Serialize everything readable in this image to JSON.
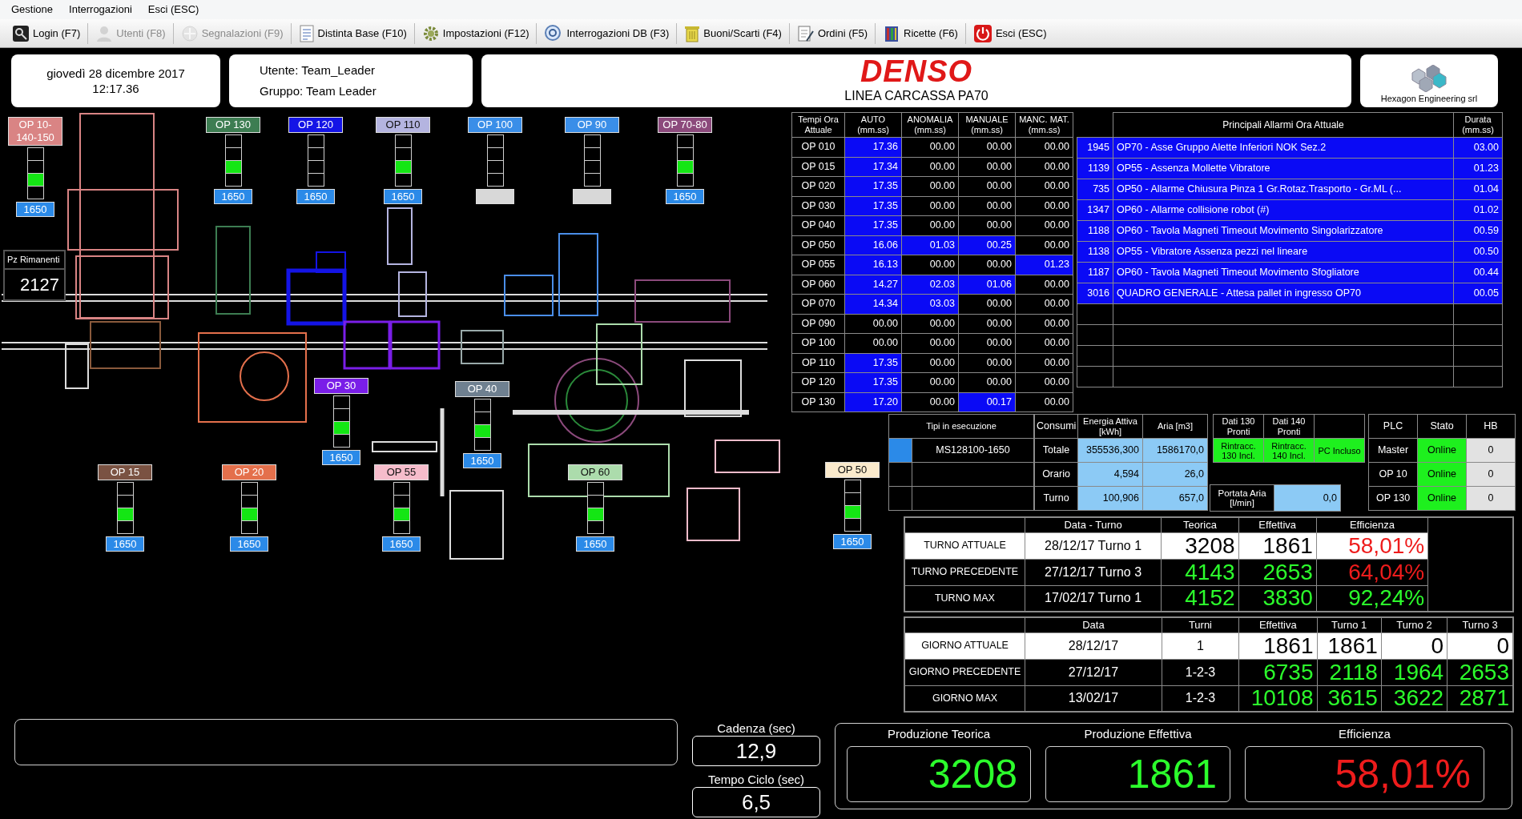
{
  "menu": [
    "Gestione",
    "Interrogazioni",
    "Esci (ESC)"
  ],
  "toolbar": [
    {
      "label": "Login (F7)",
      "disabled": false
    },
    {
      "label": "Utenti (F8)",
      "disabled": true
    },
    {
      "label": "Segnalazioni (F9)",
      "disabled": true
    },
    {
      "label": "Distinta Base (F10)",
      "disabled": false
    },
    {
      "label": "Impostazioni (F12)",
      "disabled": false
    },
    {
      "label": "Interrogazioni DB (F3)",
      "disabled": false
    },
    {
      "label": "Buoni/Scarti (F4)",
      "disabled": false
    },
    {
      "label": "Ordini (F5)",
      "disabled": false
    },
    {
      "label": "Ricette (F6)",
      "disabled": false
    },
    {
      "label": "Esci (ESC)",
      "disabled": false
    }
  ],
  "header": {
    "date": "giovedì 28 dicembre 2017",
    "time": "12:17.36",
    "user": "Utente: Team_Leader",
    "group": "Gruppo: Team Leader",
    "brand": "DENSO",
    "line": "LINEA CARCASSA PA70",
    "vendor": "Hexagon Engineering srl"
  },
  "stations": [
    {
      "label": "OP 10-140-150",
      "color": "#d98484",
      "lamps": [
        false,
        false,
        true,
        false
      ],
      "count": "1650"
    },
    {
      "label": "OP 130",
      "color": "#3d7d52",
      "lamps": [
        false,
        false,
        true,
        false
      ],
      "count": "1650"
    },
    {
      "label": "OP 120",
      "color": "#1414e6",
      "lamps": [
        false,
        false,
        false,
        false
      ],
      "count": "1650"
    },
    {
      "label": "OP 110",
      "color": "#b4b4e0",
      "lamps": [
        false,
        false,
        true,
        false
      ],
      "count": "1650"
    },
    {
      "label": "OP 100",
      "color": "#3a8ee8",
      "lamps": [
        false,
        false,
        false,
        false
      ]
    },
    {
      "label": "OP 90",
      "color": "#3a8ee8",
      "lamps": [
        false,
        false,
        false,
        false
      ]
    },
    {
      "label": "OP 70-80",
      "color": "#8c4a7c",
      "lamps": [
        false,
        false,
        true,
        false
      ],
      "count": "1650"
    },
    {
      "label": "OP 30",
      "color": "#7a1ee8",
      "lamps": [
        false,
        false,
        true,
        false
      ],
      "count": "1650"
    },
    {
      "label": "OP 40",
      "color": "#6f8090",
      "lamps": [
        false,
        false,
        true,
        false
      ],
      "count": "1650"
    },
    {
      "label": "OP 15",
      "color": "#7a5242",
      "lamps": [
        false,
        false,
        true,
        false
      ],
      "count": "1650"
    },
    {
      "label": "OP 20",
      "color": "#e4704c",
      "lamps": [
        false,
        false,
        true,
        false
      ],
      "count": "1650"
    },
    {
      "label": "OP 55",
      "color": "#f6bccb",
      "lamps": [
        false,
        false,
        true,
        false
      ],
      "count": "1650"
    },
    {
      "label": "OP 60",
      "color": "#acdcac",
      "lamps": [
        false,
        false,
        true,
        false
      ],
      "count": "1650"
    },
    {
      "label": "OP 50",
      "color": "#faeacc",
      "lamps": [
        false,
        false,
        true,
        false
      ],
      "count": "1650"
    }
  ],
  "remaining": {
    "label": "Pz Rimanenti",
    "value": "2127"
  },
  "times": {
    "columns": [
      "Tempi Ora Attuale",
      "AUTO (mm.ss)",
      "ANOMALIA (mm.ss)",
      "MANUALE (mm.ss)",
      "MANC. MAT. (mm.ss)"
    ],
    "rows": [
      {
        "cells": [
          {
            "text": "OP 010",
            "active": false
          },
          {
            "text": "17.36",
            "active": true
          },
          {
            "text": "00.00",
            "active": false
          },
          {
            "text": "00.00",
            "active": false
          },
          {
            "text": "00.00",
            "active": false
          }
        ]
      },
      {
        "cells": [
          {
            "text": "OP 015",
            "active": false
          },
          {
            "text": "17.34",
            "active": true
          },
          {
            "text": "00.00",
            "active": false
          },
          {
            "text": "00.00",
            "active": false
          },
          {
            "text": "00.00",
            "active": false
          }
        ]
      },
      {
        "cells": [
          {
            "text": "OP 020",
            "active": false
          },
          {
            "text": "17.35",
            "active": true
          },
          {
            "text": "00.00",
            "active": false
          },
          {
            "text": "00.00",
            "active": false
          },
          {
            "text": "00.00",
            "active": false
          }
        ]
      },
      {
        "cells": [
          {
            "text": "OP 030",
            "active": false
          },
          {
            "text": "17.35",
            "active": true
          },
          {
            "text": "00.00",
            "active": false
          },
          {
            "text": "00.00",
            "active": false
          },
          {
            "text": "00.00",
            "active": false
          }
        ]
      },
      {
        "cells": [
          {
            "text": "OP 040",
            "active": false
          },
          {
            "text": "17.35",
            "active": true
          },
          {
            "text": "00.00",
            "active": false
          },
          {
            "text": "00.00",
            "active": false
          },
          {
            "text": "00.00",
            "active": false
          }
        ]
      },
      {
        "cells": [
          {
            "text": "OP 050",
            "active": false
          },
          {
            "text": "16.06",
            "active": true
          },
          {
            "text": "01.03",
            "active": true
          },
          {
            "text": "00.25",
            "active": true
          },
          {
            "text": "00.00",
            "active": false
          }
        ]
      },
      {
        "cells": [
          {
            "text": "OP 055",
            "active": false
          },
          {
            "text": "16.13",
            "active": true
          },
          {
            "text": "00.00",
            "active": false
          },
          {
            "text": "00.00",
            "active": false
          },
          {
            "text": "01.23",
            "active": true
          }
        ]
      },
      {
        "cells": [
          {
            "text": "OP 060",
            "active": false
          },
          {
            "text": "14.27",
            "active": true
          },
          {
            "text": "02.03",
            "active": true
          },
          {
            "text": "01.06",
            "active": true
          },
          {
            "text": "00.00",
            "active": false
          }
        ]
      },
      {
        "cells": [
          {
            "text": "OP 070",
            "active": false
          },
          {
            "text": "14.34",
            "active": true
          },
          {
            "text": "03.03",
            "active": true
          },
          {
            "text": "00.00",
            "active": false
          },
          {
            "text": "00.00",
            "active": false
          }
        ]
      },
      {
        "cells": [
          {
            "text": "OP 090",
            "active": false
          },
          {
            "text": "00.00",
            "active": false
          },
          {
            "text": "00.00",
            "active": false
          },
          {
            "text": "00.00",
            "active": false
          },
          {
            "text": "00.00",
            "active": false
          }
        ]
      },
      {
        "cells": [
          {
            "text": "OP 100",
            "active": false
          },
          {
            "text": "00.00",
            "active": false
          },
          {
            "text": "00.00",
            "active": false
          },
          {
            "text": "00.00",
            "active": false
          },
          {
            "text": "00.00",
            "active": false
          }
        ]
      },
      {
        "cells": [
          {
            "text": "OP 110",
            "active": false
          },
          {
            "text": "17.35",
            "active": true
          },
          {
            "text": "00.00",
            "active": false
          },
          {
            "text": "00.00",
            "active": false
          },
          {
            "text": "00.00",
            "active": false
          }
        ]
      },
      {
        "cells": [
          {
            "text": "OP 120",
            "active": false
          },
          {
            "text": "17.35",
            "active": true
          },
          {
            "text": "00.00",
            "active": false
          },
          {
            "text": "00.00",
            "active": false
          },
          {
            "text": "00.00",
            "active": false
          }
        ]
      },
      {
        "cells": [
          {
            "text": "OP 130",
            "active": false
          },
          {
            "text": "17.20",
            "active": true
          },
          {
            "text": "00.00",
            "active": false
          },
          {
            "text": "00.17",
            "active": true
          },
          {
            "text": "00.00",
            "active": false
          }
        ]
      }
    ]
  },
  "alarms": {
    "title": "Principali Allarmi Ora Attuale",
    "duration_header": "Durata (mm.ss)",
    "rows": [
      {
        "code": "1945",
        "text": "OP70 - Asse Gruppo Alette Inferiori NOK Sez.2",
        "duration": "03.00"
      },
      {
        "code": "1139",
        "text": "OP55 - Assenza Mollette Vibratore",
        "duration": "01.23"
      },
      {
        "code": "735",
        "text": "OP50 - Allarme Chiusura Pinza 1 Gr.Rotaz.Trasporto - Gr.ML (...",
        "duration": "01.04"
      },
      {
        "code": "1347",
        "text": "OP60 - Allarme collisione robot (#)",
        "duration": "01.02"
      },
      {
        "code": "1188",
        "text": "OP60 - Tavola Magneti Timeout Movimento Singolarizzatore",
        "duration": "00.59"
      },
      {
        "code": "1138",
        "text": "OP55 - Vibratore Assenza pezzi nel lineare",
        "duration": "00.50"
      },
      {
        "code": "1187",
        "text": "OP60 - Tavola Magneti Timeout Movimento Sfogliatore",
        "duration": "00.44"
      },
      {
        "code": "3016",
        "text": "QUADRO GENERALE - Attesa pallet in ingresso OP70",
        "duration": "00.05"
      }
    ]
  },
  "types": {
    "header": "Tipi in esecuzione",
    "rows": [
      {
        "name": "MS128100-1650",
        "active": true
      },
      {
        "active": false
      },
      {
        "active": false
      }
    ]
  },
  "consumption": {
    "columns": [
      "Consumi",
      "Energia Attiva [kWh]",
      "Aria [m3]"
    ],
    "rows": [
      {
        "label": "Totale",
        "values": [
          "355536,300",
          "1586170,0"
        ]
      },
      {
        "label": "Orario",
        "values": [
          "4,594",
          "26,0"
        ]
      },
      {
        "label": "Turno",
        "values": [
          "100,906",
          "657,0"
        ]
      }
    ]
  },
  "data_ready": {
    "columns": [
      "Dati 130 Pronti",
      "Dati 140 Pronti"
    ],
    "flags": [
      {
        "text": "Rintracc. 130 Incl.",
        "on": true
      },
      {
        "text": "Rintracc. 140 Incl.",
        "on": true
      },
      {
        "text": "PC Incluso",
        "on": true
      }
    ]
  },
  "air_flow": {
    "label": "Portata Aria [l/min]",
    "value": "0,0"
  },
  "plc": {
    "columns": [
      "PLC",
      "Stato",
      "HB"
    ],
    "rows": [
      {
        "name": "Master",
        "status": "Online",
        "online": true,
        "hb": "0"
      },
      {
        "name": "OP 10",
        "status": "Online",
        "online": true,
        "hb": "0"
      },
      {
        "name": "OP 130",
        "status": "Online",
        "online": true,
        "hb": "0"
      }
    ]
  },
  "shifts": {
    "columns": [
      "Data - Turno",
      "Teorica",
      "Effettiva",
      "Efficienza"
    ],
    "rows": [
      {
        "label": "TURNO ATTUALE",
        "current": true,
        "date": "28/12/17 Turno 1",
        "theoretical": "3208",
        "actual": "1861",
        "efficiency": {
          "text": "58,01%",
          "color": "#ee1c1c"
        }
      },
      {
        "label": "TURNO PRECEDENTE",
        "current": false,
        "date": "27/12/17 Turno 3",
        "theoretical": "4143",
        "actual": "2653",
        "efficiency": {
          "text": "64,04%",
          "color": "#ee1c1c"
        }
      },
      {
        "label": "TURNO MAX",
        "current": false,
        "date": "17/02/17 Turno 1",
        "theoretical": "4152",
        "actual": "3830",
        "efficiency": {
          "text": "92,24%",
          "color": "#2cff2c"
        }
      }
    ]
  },
  "days": {
    "columns": [
      "Data",
      "Turni",
      "Effettiva",
      "Turno 1",
      "Turno 2",
      "Turno 3"
    ],
    "rows": [
      {
        "label": "GIORNO ATTUALE",
        "current": true,
        "date": "28/12/17",
        "shifts": "1",
        "actual": "1861",
        "turns": [
          "1861",
          "0",
          "0"
        ]
      },
      {
        "label": "GIORNO PRECEDENTE",
        "current": false,
        "date": "27/12/17",
        "shifts": "1-2-3",
        "actual": "6735",
        "turns": [
          "2118",
          "1964",
          "2653"
        ]
      },
      {
        "label": "GIORNO MAX",
        "current": false,
        "date": "13/02/17",
        "shifts": "1-2-3",
        "actual": "10108",
        "turns": [
          "3615",
          "3622",
          "2871"
        ]
      }
    ]
  },
  "cadence": {
    "label": "Cadenza (sec)",
    "value": "12,9"
  },
  "cycle_time": {
    "label": "Tempo Ciclo (sec)",
    "value": "6,5"
  },
  "production": [
    {
      "label": "Produzione Teorica",
      "value": "3208",
      "color": "#2cff2c"
    },
    {
      "label": "Produzione Effettiva",
      "value": "1861",
      "color": "#2cff2c"
    },
    {
      "label": "Efficienza",
      "value": "58,01%",
      "color": "#ee1c1c"
    }
  ]
}
